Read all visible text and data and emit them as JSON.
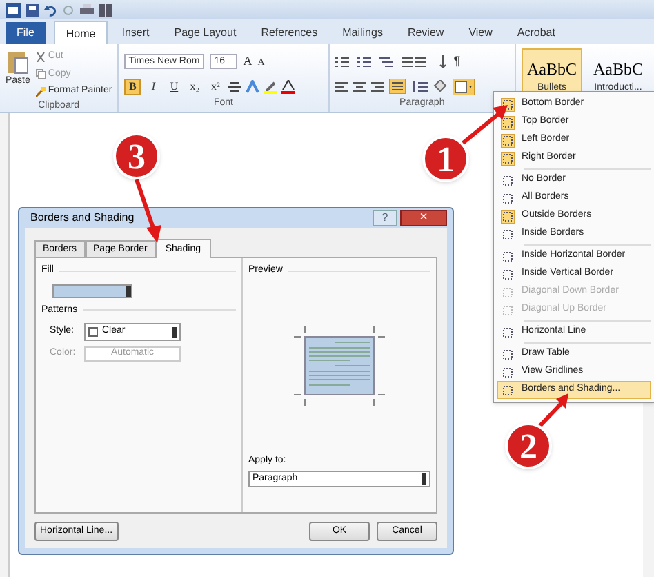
{
  "ribbon_tabs": [
    {
      "label": "File",
      "selected": false,
      "kind": "file"
    },
    {
      "label": "Home",
      "selected": true,
      "kind": "tab"
    },
    {
      "label": "Insert",
      "selected": false,
      "kind": "tab"
    },
    {
      "label": "Page Layout",
      "selected": false,
      "kind": "tab"
    },
    {
      "label": "References",
      "selected": false,
      "kind": "tab"
    },
    {
      "label": "Mailings",
      "selected": false,
      "kind": "tab"
    },
    {
      "label": "Review",
      "selected": false,
      "kind": "tab"
    },
    {
      "label": "View",
      "selected": false,
      "kind": "tab"
    },
    {
      "label": "Acrobat",
      "selected": false,
      "kind": "tab"
    }
  ],
  "clipboard": {
    "paste": "Paste",
    "cut": "Cut",
    "copy": "Copy",
    "format_painter": "Format Painter",
    "label": "Clipboard"
  },
  "font": {
    "name": "Times New Rom",
    "size": "16",
    "grow": "A",
    "shrink": "A",
    "label": "Font",
    "buttons": [
      {
        "label": "B",
        "selected": true
      },
      {
        "label": "I",
        "selected": false
      },
      {
        "label": "U",
        "selected": false
      },
      {
        "label": "x₂",
        "selected": false
      },
      {
        "label": "x²",
        "selected": false
      }
    ]
  },
  "paragraph": {
    "label": "Paragraph",
    "pilcrow": "¶"
  },
  "styles": [
    {
      "sample": "AaBbC",
      "name": "Bullets",
      "selected": true
    },
    {
      "sample": "AaBbC",
      "name": "Introducti...",
      "selected": false
    }
  ],
  "border_menu": [
    [
      {
        "label": "Bottom Border",
        "checked": true,
        "disabled": false,
        "selected": false
      },
      {
        "label": "Top Border",
        "checked": true,
        "disabled": false,
        "selected": false
      },
      {
        "label": "Left Border",
        "checked": true,
        "disabled": false,
        "selected": false
      },
      {
        "label": "Right Border",
        "checked": true,
        "disabled": false,
        "selected": false
      }
    ],
    [
      {
        "label": "No Border",
        "checked": false,
        "disabled": false,
        "selected": false
      },
      {
        "label": "All Borders",
        "checked": false,
        "disabled": false,
        "selected": false
      },
      {
        "label": "Outside Borders",
        "checked": true,
        "disabled": false,
        "selected": false
      },
      {
        "label": "Inside Borders",
        "checked": false,
        "disabled": false,
        "selected": false
      }
    ],
    [
      {
        "label": "Inside Horizontal Border",
        "checked": false,
        "disabled": false,
        "selected": false
      },
      {
        "label": "Inside Vertical Border",
        "checked": false,
        "disabled": false,
        "selected": false
      },
      {
        "label": "Diagonal Down Border",
        "checked": false,
        "disabled": true,
        "selected": false
      },
      {
        "label": "Diagonal Up Border",
        "checked": false,
        "disabled": true,
        "selected": false
      }
    ],
    [
      {
        "label": "Horizontal Line",
        "checked": false,
        "disabled": false,
        "selected": false
      }
    ],
    [
      {
        "label": "Draw Table",
        "checked": false,
        "disabled": false,
        "selected": false
      },
      {
        "label": "View Gridlines",
        "checked": false,
        "disabled": false,
        "selected": false
      },
      {
        "label": "Borders and Shading...",
        "checked": false,
        "disabled": false,
        "selected": true
      }
    ]
  ],
  "dialog": {
    "title": "Borders and Shading",
    "help": "?",
    "close": "×",
    "tabs": [
      {
        "label": "Borders",
        "selected": false
      },
      {
        "label": "Page Border",
        "selected": false
      },
      {
        "label": "Shading",
        "selected": true
      }
    ],
    "fill_label": "Fill",
    "patterns_label": "Patterns",
    "style_label": "Style:",
    "style_value": "Clear",
    "color_label": "Color:",
    "color_value": "Automatic",
    "color_disabled": true,
    "preview_label": "Preview",
    "apply_to_label": "Apply to:",
    "apply_to_value": "Paragraph",
    "buttons": [
      "Horizontal Line...",
      "OK",
      "Cancel"
    ]
  },
  "callouts": [
    "1",
    "3",
    "2"
  ]
}
